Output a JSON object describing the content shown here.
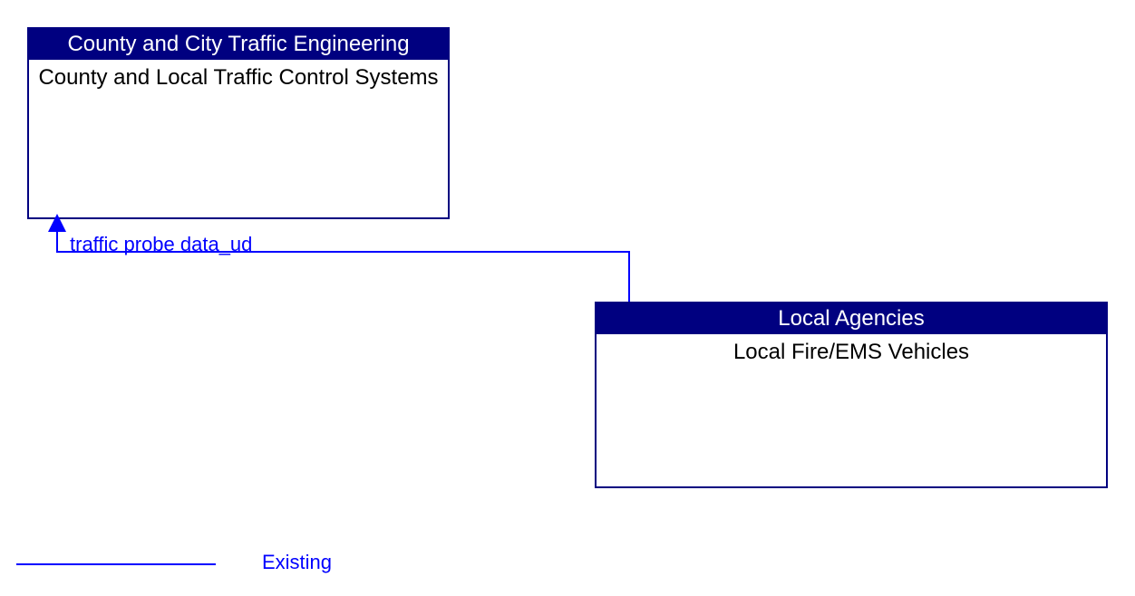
{
  "nodes": {
    "top_left": {
      "header": "County and City Traffic Engineering",
      "body": "County and Local Traffic Control Systems"
    },
    "bottom_right": {
      "header": "Local Agencies",
      "body": "Local Fire/EMS Vehicles"
    }
  },
  "connector": {
    "label": "traffic probe data_ud"
  },
  "legend": {
    "label": "Existing"
  },
  "colors": {
    "brand": "#000080",
    "link": "#0000ff"
  }
}
